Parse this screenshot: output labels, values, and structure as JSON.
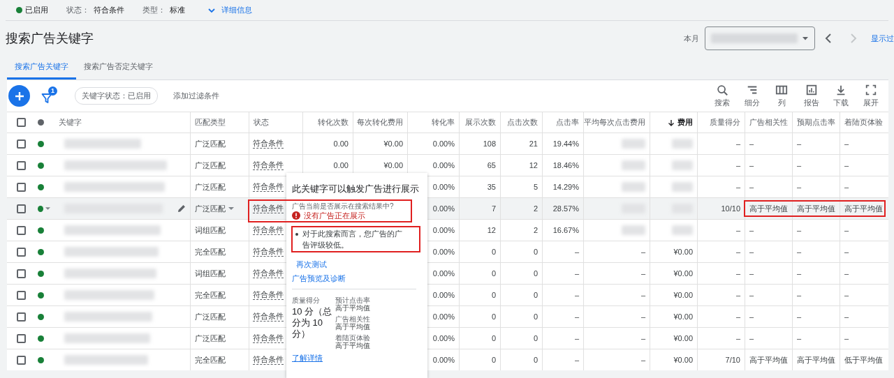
{
  "summary": {
    "status": {
      "label": "已启用",
      "enabled": true
    },
    "fields": [
      {
        "label": "状态：",
        "value": "符合条件"
      },
      {
        "label": "类型：",
        "value": "标准"
      }
    ],
    "details_link": "详细信息"
  },
  "page": {
    "title": "搜索广告关键字",
    "date_label": "本月",
    "date_hidden": true,
    "next_disabled": true,
    "more_link": "显示过"
  },
  "tabs": [
    {
      "label": "搜索广告关键字",
      "selected": true
    },
    {
      "label": "搜索广告否定关键字",
      "selected": false
    }
  ],
  "toolbar": {
    "filter_count": "1",
    "filters": [
      "关键字状态：已启用"
    ],
    "add_filter": "添加过滤条件",
    "tools": [
      {
        "kind": "search",
        "label": "搜索"
      },
      {
        "kind": "segment",
        "label": "细分"
      },
      {
        "kind": "columns",
        "label": "列"
      },
      {
        "kind": "report",
        "label": "报告"
      },
      {
        "kind": "download",
        "label": "下载"
      },
      {
        "kind": "expand",
        "label": "展开"
      }
    ]
  },
  "table": {
    "all_selected": false,
    "keywords_hidden": true,
    "columns": [
      {
        "label": "关键字",
        "sorted": false
      },
      {
        "label": "匹配类型",
        "sorted": false
      },
      {
        "label": "状态",
        "sorted": false
      },
      {
        "label": "转化次数",
        "sorted": false
      },
      {
        "label": "每次转化费用",
        "sorted": false
      },
      {
        "label": "转化率",
        "sorted": false
      },
      {
        "label": "展示次数",
        "sorted": false
      },
      {
        "label": "点击次数",
        "sorted": false
      },
      {
        "label": "点击率",
        "sorted": false
      },
      {
        "label": "平均每次点击费用",
        "sorted": false
      },
      {
        "label": "费用",
        "sorted": true
      },
      {
        "label": "质量得分",
        "sorted": false
      },
      {
        "label": "广告相关性",
        "sorted": false
      },
      {
        "label": "预期点击率",
        "sorted": false
      },
      {
        "label": "着陆页体验",
        "sorted": false
      }
    ],
    "rows": [
      {
        "selected": false,
        "enabled": true,
        "hovered": false,
        "annotated": false,
        "match": "广泛匹配",
        "status": "符合条件",
        "conv": "0.00",
        "cost_conv": "¥0.00",
        "conv_rate": "0.00%",
        "impr": "108",
        "clicks": "21",
        "ctr": "19.44%",
        "avg_cpc": null,
        "cost": null,
        "qs": "–",
        "rel": "–",
        "exp_ctr": "–",
        "landing": "–"
      },
      {
        "selected": false,
        "enabled": true,
        "hovered": false,
        "annotated": false,
        "match": "广泛匹配",
        "status": "符合条件",
        "conv": "0.00",
        "cost_conv": "¥0.00",
        "conv_rate": "0.00%",
        "impr": "65",
        "clicks": "12",
        "ctr": "18.46%",
        "avg_cpc": null,
        "cost": null,
        "qs": "–",
        "rel": "–",
        "exp_ctr": "–",
        "landing": "–"
      },
      {
        "selected": false,
        "enabled": true,
        "hovered": false,
        "annotated": false,
        "match": "广泛匹配",
        "status": "符合条件",
        "conv_rate": "0.00%",
        "impr": "35",
        "clicks": "5",
        "ctr": "14.29%",
        "avg_cpc": null,
        "cost": null,
        "qs": "–",
        "rel": "–",
        "exp_ctr": "–",
        "landing": "–"
      },
      {
        "selected": false,
        "enabled": true,
        "hovered": true,
        "annotated": true,
        "match": "广泛匹配",
        "status": "符合条件",
        "conv_rate": "0.00%",
        "impr": "7",
        "clicks": "2",
        "ctr": "28.57%",
        "avg_cpc": null,
        "cost": null,
        "qs": "10/10",
        "rel": "高于平均值",
        "exp_ctr": "高于平均值",
        "landing": "高于平均值"
      },
      {
        "selected": false,
        "enabled": true,
        "hovered": false,
        "annotated": false,
        "match": "词组匹配",
        "status": "符合条件",
        "conv_rate": "0.00%",
        "impr": "12",
        "clicks": "2",
        "ctr": "16.67%",
        "avg_cpc": null,
        "cost": null,
        "qs": "–",
        "rel": "–",
        "exp_ctr": "–",
        "landing": "–"
      },
      {
        "selected": false,
        "enabled": true,
        "hovered": false,
        "annotated": false,
        "match": "完全匹配",
        "status": "符合条件",
        "conv_rate": "0.00%",
        "impr": "0",
        "clicks": "0",
        "ctr": "–",
        "avg_cpc": "–",
        "cost": "¥0.00",
        "qs": "–",
        "rel": "–",
        "exp_ctr": "–",
        "landing": "–"
      },
      {
        "selected": false,
        "enabled": true,
        "hovered": false,
        "annotated": false,
        "match": "词组匹配",
        "status": "符合条件",
        "conv_rate": "0.00%",
        "impr": "0",
        "clicks": "0",
        "ctr": "–",
        "avg_cpc": "–",
        "cost": "¥0.00",
        "qs": "–",
        "rel": "–",
        "exp_ctr": "–",
        "landing": "–"
      },
      {
        "selected": false,
        "enabled": true,
        "hovered": false,
        "annotated": false,
        "match": "完全匹配",
        "status": "符合条件",
        "conv_rate": "0.00%",
        "impr": "0",
        "clicks": "0",
        "ctr": "–",
        "avg_cpc": "–",
        "cost": "¥0.00",
        "qs": "–",
        "rel": "–",
        "exp_ctr": "–",
        "landing": "–"
      },
      {
        "selected": false,
        "enabled": true,
        "hovered": false,
        "annotated": false,
        "match": "广泛匹配",
        "status": "符合条件",
        "conv_rate": "0.00%",
        "impr": "0",
        "clicks": "0",
        "ctr": "–",
        "avg_cpc": "–",
        "cost": "¥0.00",
        "qs": "–",
        "rel": "–",
        "exp_ctr": "–",
        "landing": "–"
      },
      {
        "selected": false,
        "enabled": true,
        "hovered": false,
        "annotated": false,
        "match": "广泛匹配",
        "status": "符合条件",
        "conv_rate": "0.00%",
        "impr": "0",
        "clicks": "0",
        "ctr": "–",
        "avg_cpc": "–",
        "cost": "¥0.00",
        "qs": "–",
        "rel": "–",
        "exp_ctr": "–",
        "landing": "–"
      },
      {
        "selected": false,
        "enabled": true,
        "hovered": false,
        "annotated": false,
        "match": "完全匹配",
        "status": "符合条件",
        "conv_rate": "0.00%",
        "impr": "0",
        "clicks": "0",
        "ctr": "–",
        "avg_cpc": "–",
        "cost": "¥0.00",
        "qs": "7/10",
        "rel": "高于平均值",
        "exp_ctr": "高于平均值",
        "landing": "低于平均值"
      }
    ]
  },
  "popup": {
    "title": "此关键字可以触发广告进行展示",
    "question": "广告当前是否展示在搜索结果中?",
    "error": "没有广告正在展示",
    "reasons": [
      "对于此搜索而言，您广告的广告评级较低。"
    ],
    "annotated": true,
    "links": [
      "再次测试",
      "广告预览及诊断"
    ],
    "score_label": "质量得分",
    "score": "10 分（总分为 10 分）",
    "components": [
      {
        "label": "预计点击率",
        "value": "高于平均值"
      },
      {
        "label": "广告相关性",
        "value": "高于平均值"
      },
      {
        "label": "着陆页体验",
        "value": "高于平均值"
      }
    ],
    "learn_more": "了解详情"
  }
}
